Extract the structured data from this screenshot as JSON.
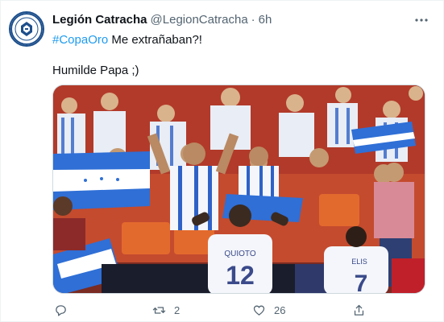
{
  "tweet": {
    "display_name": "Legión Catracha",
    "handle": "@LegionCatracha",
    "separator": "·",
    "time": "6h",
    "hashtag": "#CopaOro",
    "text_after_hashtag": " Me extrañaban?!",
    "line2": "Humilde Papa ;)",
    "more_icon": "more-options-icon"
  },
  "media": {
    "description_colors": {
      "stands": "#c0392b",
      "jersey_white": "#f4f6fb",
      "flag_blue": "#2f6fd6",
      "ad_board": "#1a1d2b"
    },
    "jersey_numbers": [
      "12",
      "7"
    ],
    "jersey_names": [
      "QUIOTO",
      "ELIS"
    ]
  },
  "actions": {
    "reply_count": "",
    "retweet_count": "2",
    "like_count": "26",
    "share_count": ""
  }
}
